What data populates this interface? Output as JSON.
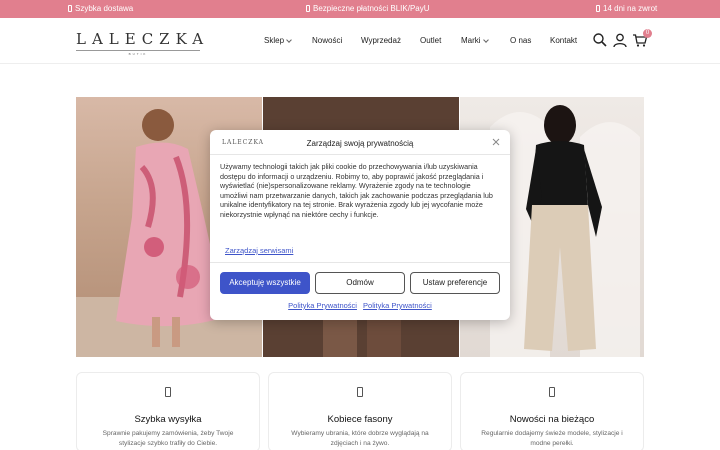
{
  "topbar": {
    "items": [
      {
        "label": "Szybka dostawa",
        "icon": "box-icon"
      },
      {
        "label": "Bezpieczne płatności BLIK/PayU",
        "icon": "lock-icon"
      },
      {
        "label": "14 dni na zwrot",
        "icon": "return-icon"
      }
    ],
    "color": "#e17f8e"
  },
  "header": {
    "logo": "LALECZKA",
    "logo_sub": "BUTIK",
    "nav": [
      {
        "label": "Sklep",
        "dropdown": true
      },
      {
        "label": "Nowości",
        "dropdown": false
      },
      {
        "label": "Wyprzedaż",
        "dropdown": false
      },
      {
        "label": "Outlet",
        "dropdown": false
      },
      {
        "label": "Marki",
        "dropdown": true
      },
      {
        "label": "O nas",
        "dropdown": false
      },
      {
        "label": "Kontakt",
        "dropdown": false
      }
    ],
    "cart_count": "0",
    "icons": [
      "search-icon",
      "user-icon",
      "cart-icon"
    ]
  },
  "cookie_modal": {
    "logo": "LALECZKA",
    "title": "Zarządzaj swoją prywatnością",
    "body": "Używamy technologii takich jak pliki cookie do przechowywania i/lub uzyskiwania dostępu do informacji o urządzeniu. Robimy to, aby poprawić jakość przeglądania i wyświetlać (nie)spersonalizowane reklamy. Wyrażenie zgody na te technologie umożliwi nam przetwarzanie danych, takich jak zachowanie podczas przeglądania lub unikalne identyfikatory na tej stronie. Brak wyrażenia zgody lub jej wycofanie może niekorzystnie wpłynąć na niektóre cechy i funkcje.",
    "manage_link": "Zarządzaj serwisami",
    "accept_label": "Akceptuję wszystkie",
    "deny_label": "Odmów",
    "prefs_label": "Ustaw preferencje",
    "links": [
      "Polityka Prywatności",
      "Polityka Prywatności"
    ],
    "accent": "#3e54c9"
  },
  "features": [
    {
      "title": "Szybka wysyłka",
      "text": "Sprawnie pakujemy zamówienia, żeby Twoje stylizacje szybko trafiły do Ciebie.",
      "icon": "box-icon"
    },
    {
      "title": "Kobiece fasony",
      "text": "Wybieramy ubrania, które dobrze wyglądają na zdjęciach i na żywo.",
      "icon": "dress-icon"
    },
    {
      "title": "Nowości na bieżąco",
      "text": "Regularnie dodajemy świeże modele, stylizacje i modne perełki.",
      "icon": "sparkle-icon"
    }
  ]
}
